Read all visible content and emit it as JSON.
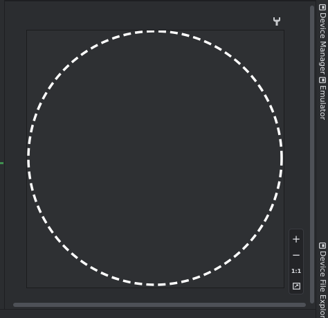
{
  "preview": {
    "device_shape": "round",
    "outline_color": "#ffffff",
    "canvas_color": "#2e3033"
  },
  "icons": {
    "wrench": "wrench-icon",
    "zoom_fit": "fit-screen-icon",
    "device": "device-icon"
  },
  "zoom": {
    "zoom_in_label": "+",
    "zoom_out_label": "−",
    "actual_size_label": "1:1"
  },
  "right_toolbar": {
    "tabs": [
      {
        "label": "Device Manager"
      },
      {
        "label": "Emulator"
      },
      {
        "label": "Device File Explorer"
      }
    ]
  },
  "colors": {
    "background": "#2b2d30",
    "scrollbar": "#4e5157",
    "text": "#dfe1e5",
    "accent": "#3f8f4f"
  }
}
